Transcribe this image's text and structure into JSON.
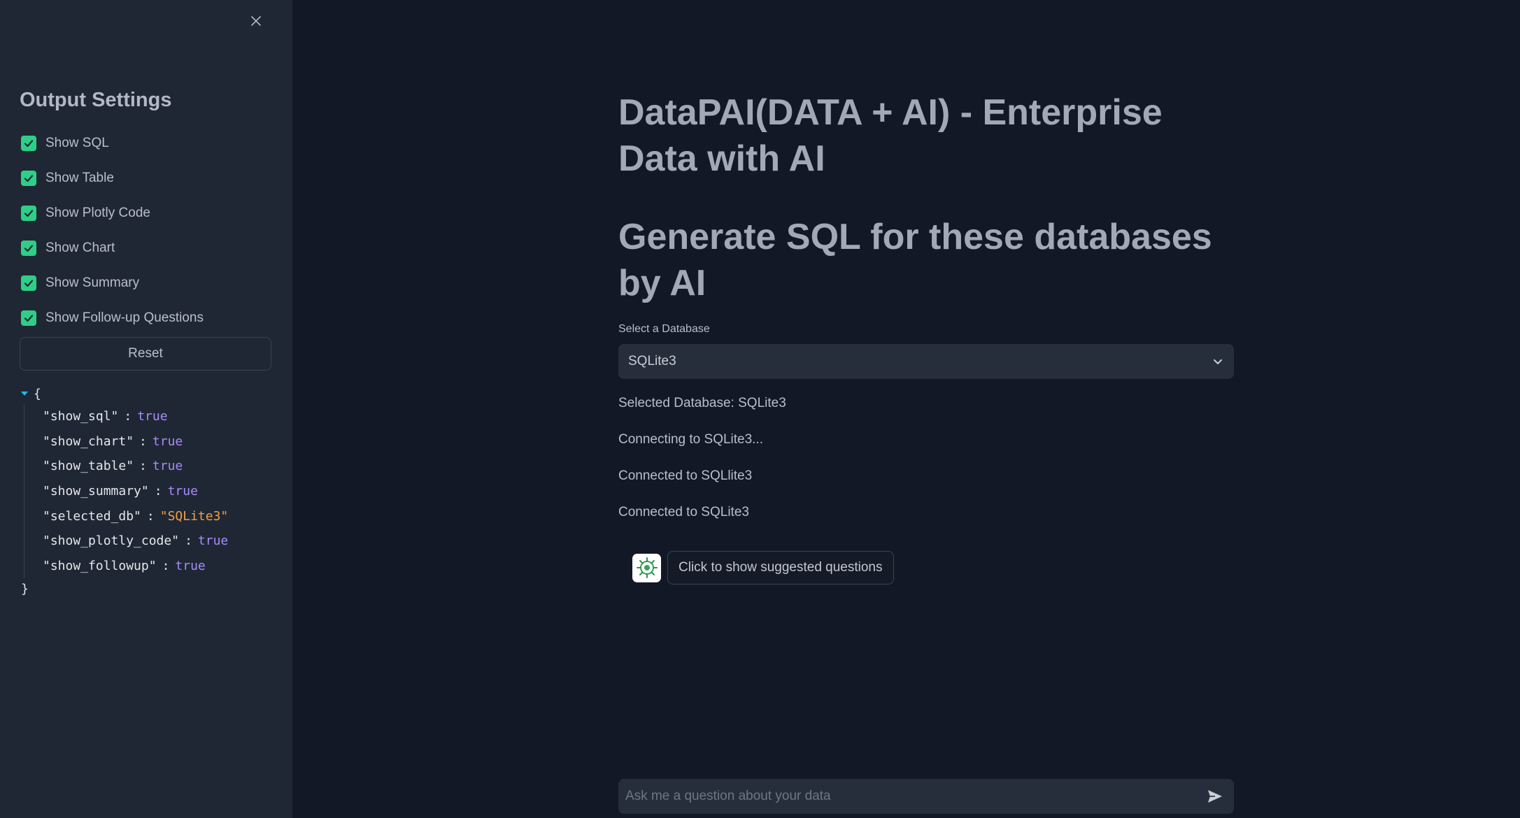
{
  "sidebar": {
    "close_icon": "close-icon",
    "title": "Output Settings",
    "checkboxes": [
      {
        "label": "Show SQL",
        "checked": true
      },
      {
        "label": "Show Table",
        "checked": true
      },
      {
        "label": "Show Plotly Code",
        "checked": true
      },
      {
        "label": "Show Chart",
        "checked": true
      },
      {
        "label": "Show Summary",
        "checked": true
      },
      {
        "label": "Show Follow-up Questions",
        "checked": true
      }
    ],
    "reset_label": "Reset",
    "json_view": {
      "open_brace": "{",
      "close_brace": "}",
      "entries": [
        {
          "key": "\"show_sql\"",
          "value": "true",
          "type": "bool"
        },
        {
          "key": "\"show_chart\"",
          "value": "true",
          "type": "bool"
        },
        {
          "key": "\"show_table\"",
          "value": "true",
          "type": "bool"
        },
        {
          "key": "\"show_summary\"",
          "value": "true",
          "type": "bool"
        },
        {
          "key": "\"selected_db\"",
          "value": "\"SQLite3\"",
          "type": "string"
        },
        {
          "key": "\"show_plotly_code\"",
          "value": "true",
          "type": "bool"
        },
        {
          "key": "\"show_followup\"",
          "value": "true",
          "type": "bool"
        }
      ]
    }
  },
  "main": {
    "title": "DataPAI(DATA + AI) - Enterprise Data with AI",
    "subtitle": "Generate SQL for these databases by AI",
    "select": {
      "label": "Select a Database",
      "value": "SQLite3",
      "icon": "chevron-down-icon"
    },
    "status_lines": [
      "Selected Database: SQLite3",
      "Connecting to SQLite3...",
      "Connected to SQLlite3",
      "Connected to SQLite3"
    ],
    "suggest_button": "Click to show suggested questions",
    "chat": {
      "placeholder": "Ask me a question about your data",
      "send_icon": "send-icon"
    }
  },
  "colors": {
    "background": "#121826",
    "sidebar": "#1f2734",
    "checkbox": "#2fce87",
    "json_bool": "#a78bfa",
    "json_string": "#f59e42"
  }
}
